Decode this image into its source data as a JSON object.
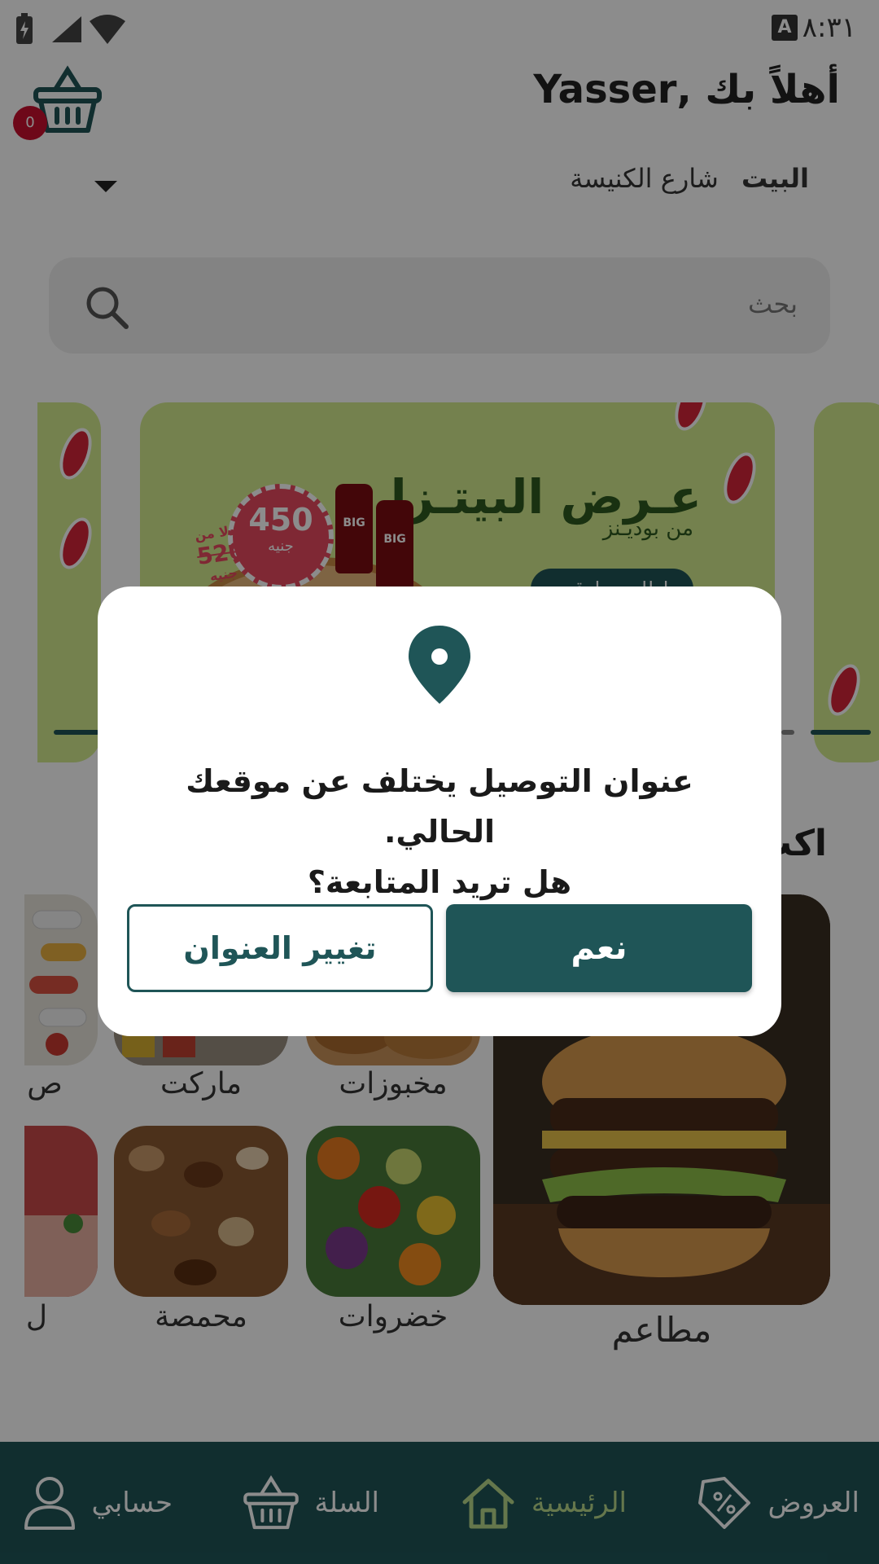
{
  "status_bar": {
    "time": "٨:٣١",
    "keyboard_indicator": "A"
  },
  "header": {
    "greeting": "أهلاً بك ,Yasser",
    "cart_count": "0",
    "address_label": "البيت",
    "address_value": "شارع الكنيسة"
  },
  "search": {
    "placeholder": "بحث"
  },
  "banner": {
    "title": "عـرض البيتـزا",
    "subtitle": "من بوديـنز",
    "button": "اطلب بدلوقت",
    "price": "450",
    "price_unit": "جنيه",
    "old_price_prefix": "بدلا من",
    "old_price": "520",
    "old_price_unit": "جنيه",
    "bottle_label": "BIG"
  },
  "section": {
    "title_partial": "اكت"
  },
  "categories": {
    "restaurants": "مطاعم",
    "bakery": "مخبوزات",
    "market": "ماركت",
    "pharmacy_partial": "ص",
    "vegetables": "خضروات",
    "roastery": "محمصة",
    "butcher_partial": "ل"
  },
  "dialog": {
    "message_line1": "عنوان التوصيل يختلف عن موقعك الحالي.",
    "message_line2": "هل تريد المتابعة؟",
    "yes_button": "نعم",
    "change_button": "تغيير العنوان"
  },
  "bottom_nav": {
    "offers": "العروض",
    "home": "الرئيسية",
    "cart": "السلة",
    "account": "حسابي"
  },
  "colors": {
    "primary": "#1f5557",
    "active_nav": "#b8d98a",
    "badge": "#c8102e",
    "banner_bg": "#d3ec8f"
  }
}
